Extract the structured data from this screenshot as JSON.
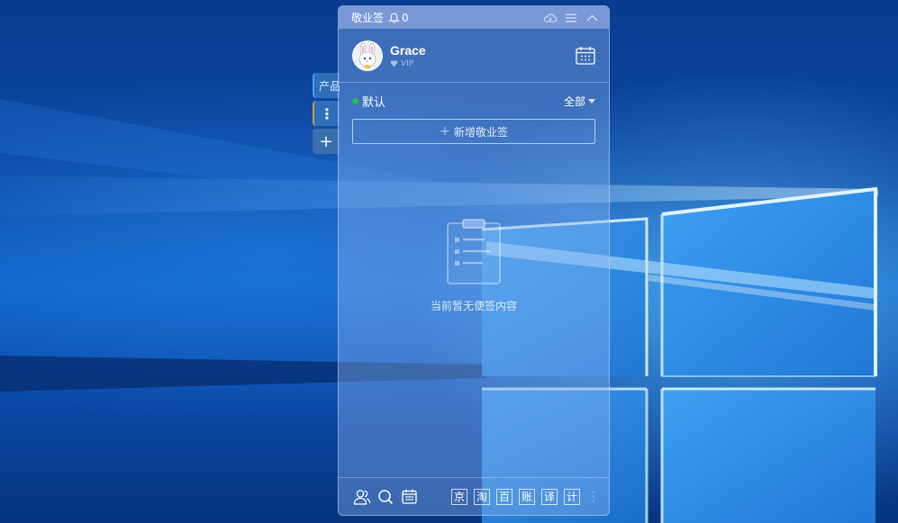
{
  "app": {
    "title": "敬业签",
    "notification_count": "0"
  },
  "side_tabs": [
    {
      "label": "产品"
    },
    {
      "label": "⋮"
    },
    {
      "label": "+"
    }
  ],
  "profile": {
    "name": "Grace",
    "level": "VIP"
  },
  "group": {
    "name": "默认",
    "filter": "全部"
  },
  "add_note_label": "新增敬业签",
  "empty_state": {
    "text": "当前暂无便签内容"
  },
  "shortcuts": [
    "京",
    "淘",
    "百",
    "账",
    "译",
    "计"
  ],
  "icons": {
    "notification": "bell-icon",
    "cloud": "cloud-icon",
    "menu": "menu-icon",
    "collapse": "chevron-up-icon",
    "calendar": "calendar-icon",
    "team": "team-icon",
    "search": "search-icon",
    "calendar_note": "calendar-note-icon",
    "empty": "clipboard-icon"
  },
  "colors": {
    "online_dot": "#27c04a",
    "titlebar": "#8aa3db"
  }
}
